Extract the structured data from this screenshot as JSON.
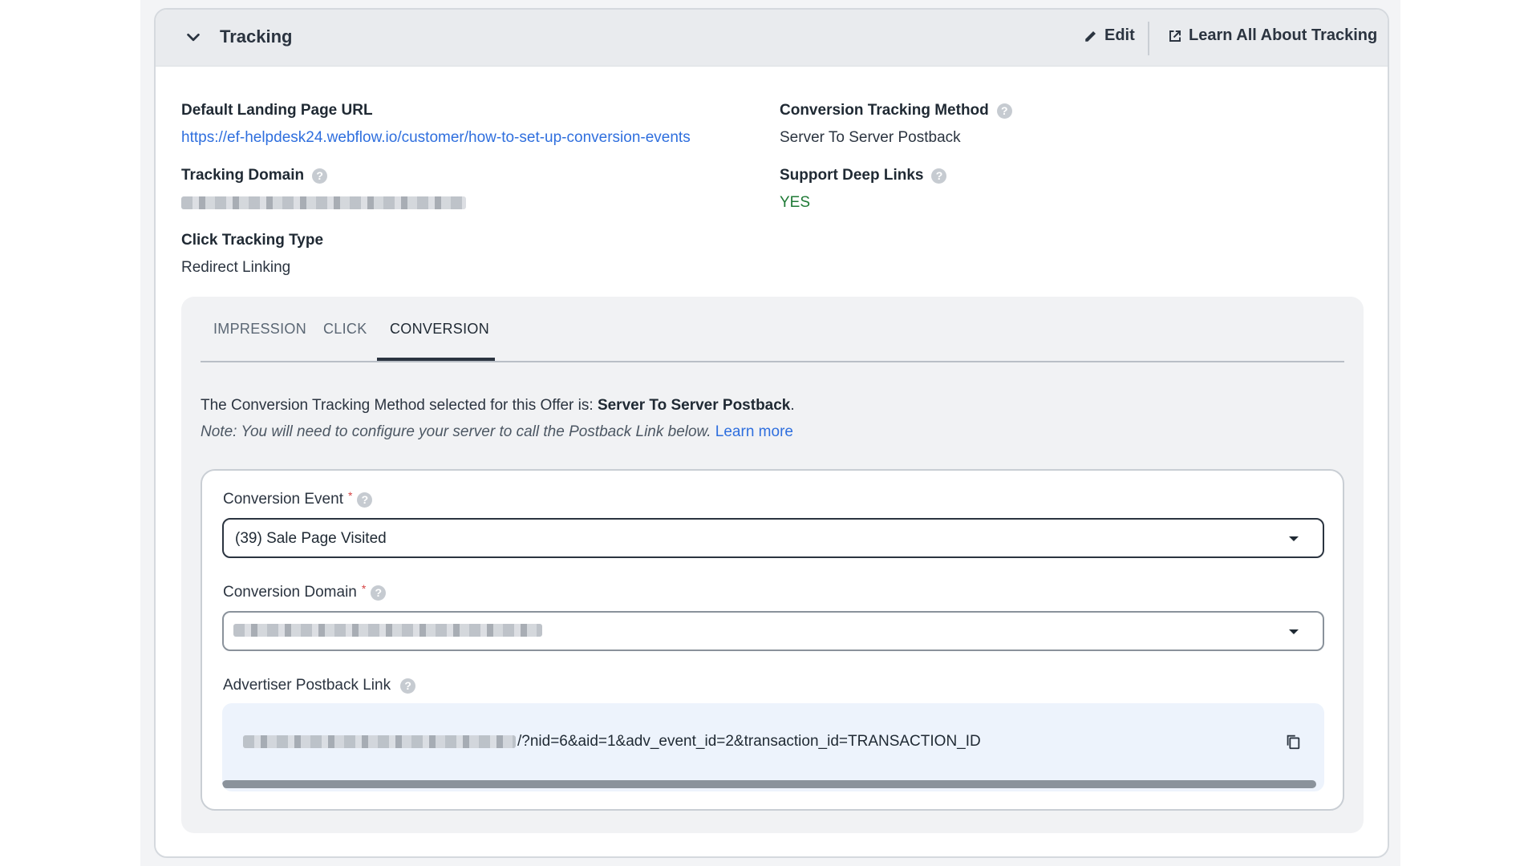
{
  "header": {
    "title": "Tracking",
    "edit_label": "Edit",
    "learn_label": "Learn All About Tracking",
    "icons": {
      "collapse": "chevron-down-icon",
      "edit": "pencil-icon",
      "learn": "external-link-icon"
    }
  },
  "fields": {
    "landing_url": {
      "label": "Default Landing Page URL",
      "value": "https://ef-helpdesk24.webflow.io/customer/how-to-set-up-conversion-events"
    },
    "tracking_domain": {
      "label": "Tracking Domain",
      "value_redacted": true
    },
    "click_tracking_type": {
      "label": "Click Tracking Type",
      "value": "Redirect Linking"
    },
    "conversion_method": {
      "label": "Conversion Tracking Method",
      "value": "Server To Server Postback"
    },
    "deep_links": {
      "label": "Support Deep Links",
      "value": "YES"
    }
  },
  "help_glyph": "?",
  "tabs": [
    {
      "label": "IMPRESSION",
      "active": false
    },
    {
      "label": "CLICK",
      "active": false
    },
    {
      "label": "CONVERSION",
      "active": true
    }
  ],
  "conversion": {
    "desc_prefix": "The Conversion Tracking Method selected for this Offer is: ",
    "desc_method": "Server To Server Postback",
    "desc_suffix": ".",
    "note": "Note: You will need to configure your server to call the Postback Link below.",
    "note_link": "Learn more",
    "event_label": "Conversion Event",
    "event_value": "(39) Sale Page Visited",
    "domain_label": "Conversion Domain",
    "required_mark": "*",
    "postback_label": "Advertiser Postback Link",
    "postback_visible_suffix": "/?nid=6&aid=1&adv_event_id=2&transaction_id=TRANSACTION_ID"
  },
  "colors": {
    "accent_link": "#2f6fde",
    "yes_green": "#1f7a36",
    "required_red": "#d64545",
    "postback_bg": "#edf3fc"
  }
}
